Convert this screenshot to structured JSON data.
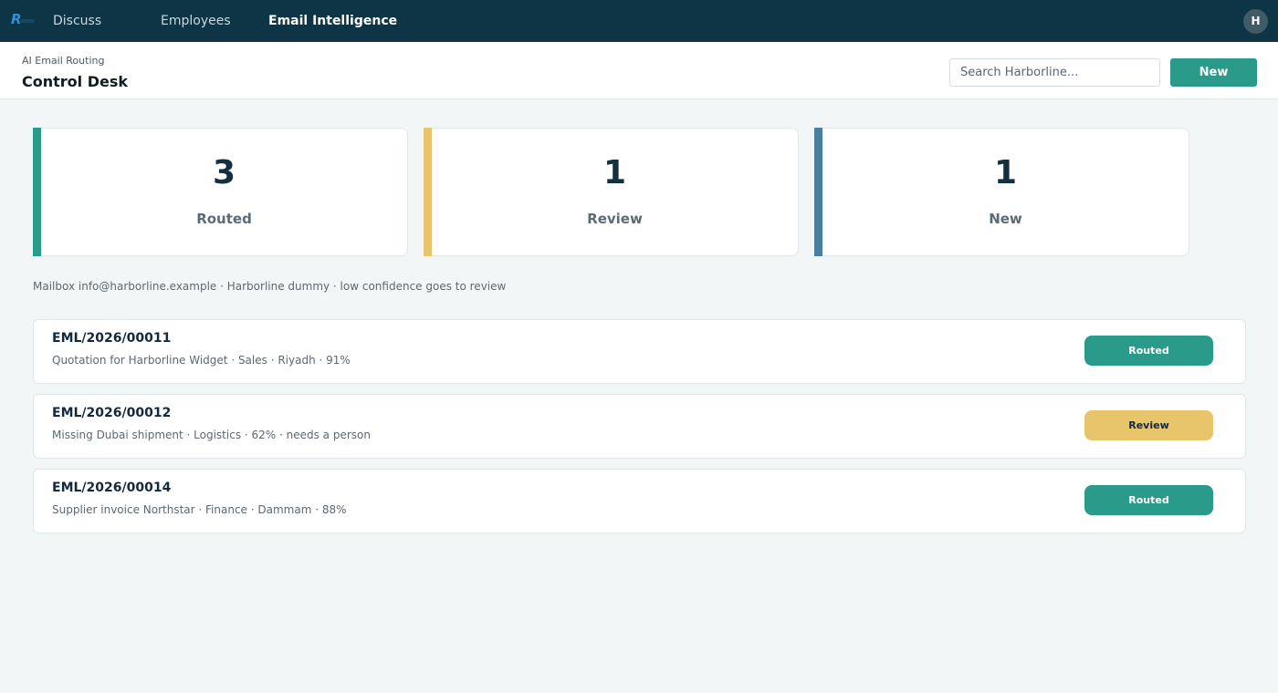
{
  "nav": {
    "items": [
      {
        "label": "Discuss"
      },
      {
        "label": "Employees"
      },
      {
        "label": "Email Intelligence"
      }
    ],
    "avatar_initial": "H"
  },
  "control_panel": {
    "breadcrumb": "AI Email Routing",
    "title": "Control Desk",
    "search_placeholder": "Search Harborline...",
    "new_label": "New"
  },
  "kpis": [
    {
      "value": "3",
      "label": "Routed",
      "color": "#2a9b8b"
    },
    {
      "value": "1",
      "label": "Review",
      "color": "#e8c46a"
    },
    {
      "value": "1",
      "label": "New",
      "color": "#4a7f9f"
    }
  ],
  "info_line": "Mailbox info@harborline.example  ·  Harborline dummy  ·  low confidence goes to review",
  "emails": [
    {
      "ref": "EML/2026/00011",
      "meta": "Quotation for Harborline Widget  ·  Sales  ·  Riyadh  ·  91%",
      "status": "Routed",
      "status_bg": "#2a9b8b",
      "status_fg": "#ffffff"
    },
    {
      "ref": "EML/2026/00012",
      "meta": "Missing Dubai shipment  ·  Logistics  ·  62%  ·  needs a person",
      "status": "Review",
      "status_bg": "#e8c46a",
      "status_fg": "#13293d"
    },
    {
      "ref": "EML/2026/00014",
      "meta": "Supplier invoice Northstar  ·  Finance  ·  Dammam  ·  88%",
      "status": "Routed",
      "status_bg": "#2a9b8b",
      "status_fg": "#ffffff"
    }
  ]
}
